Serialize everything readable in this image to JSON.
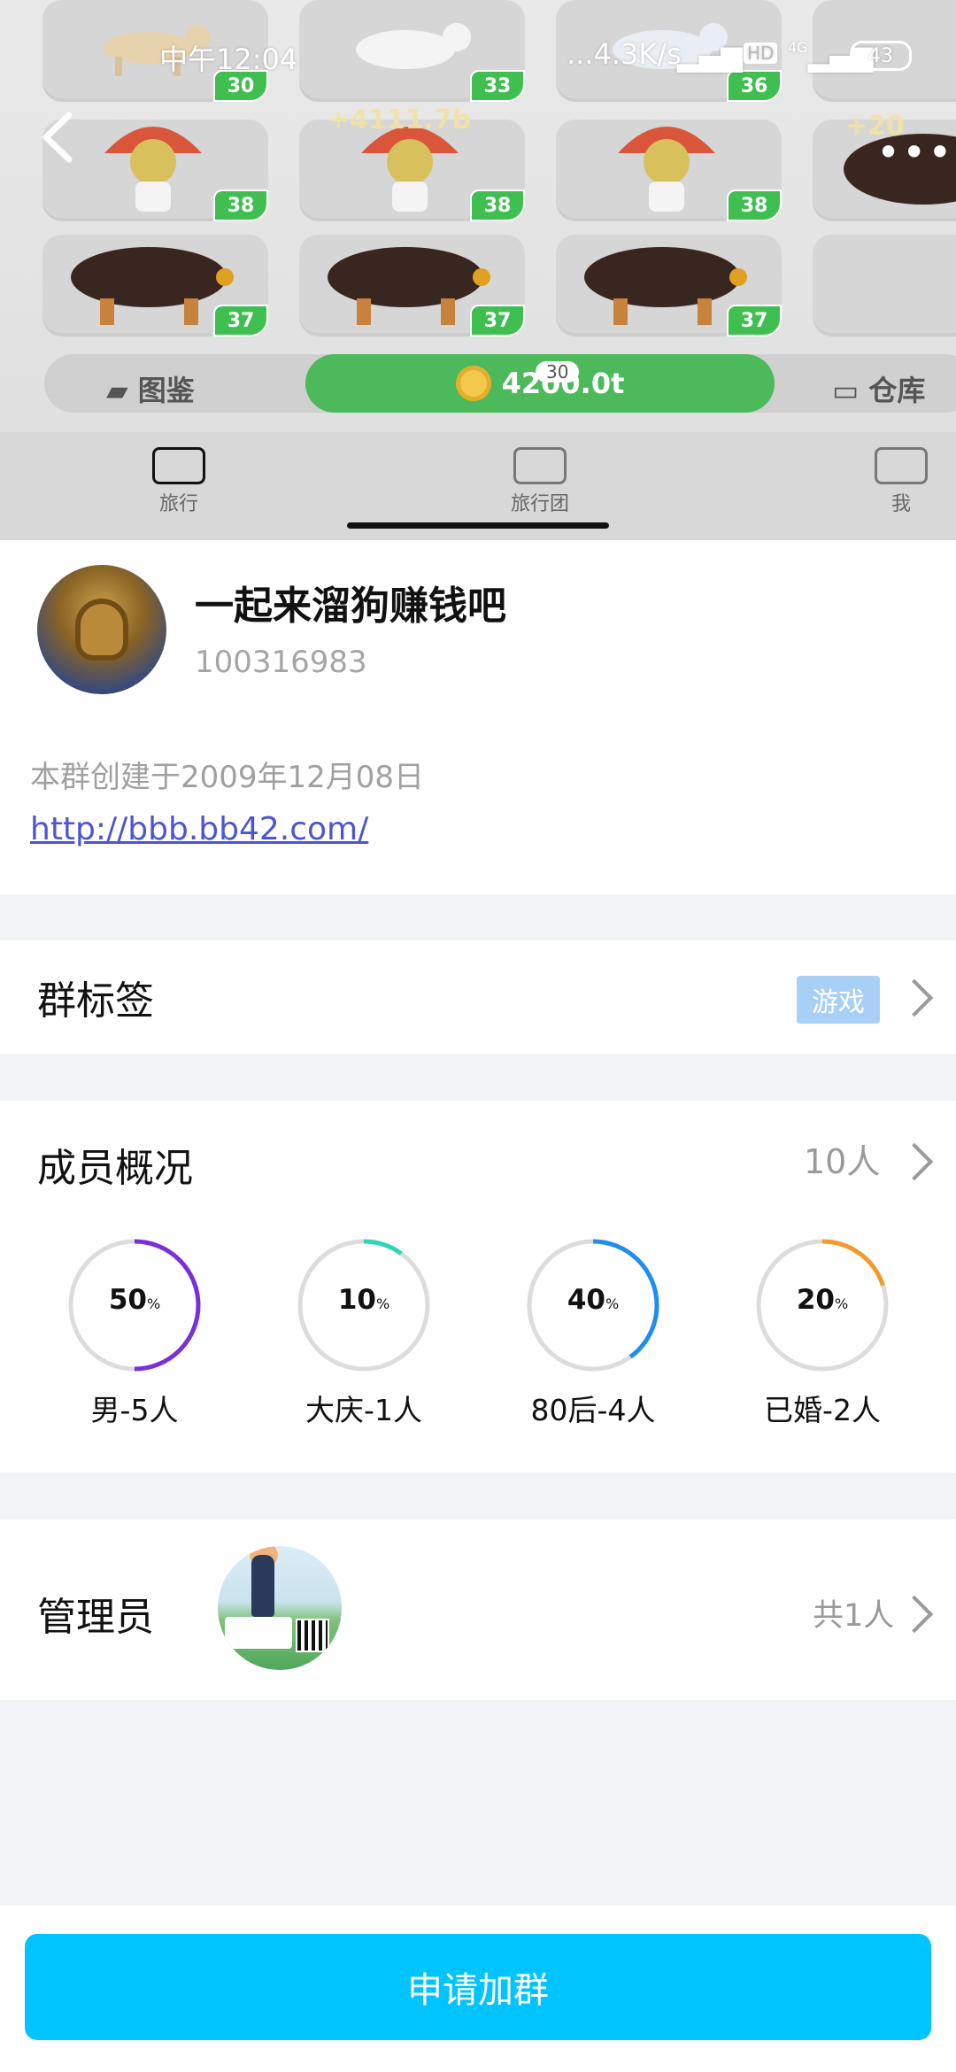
{
  "status_bar": {
    "time": "中午12:04",
    "network_speed": "...4.3K/s",
    "hd": "HD",
    "network_type": "4G",
    "battery": "43"
  },
  "banner": {
    "tiles": [
      {
        "level": "30"
      },
      {
        "level": "33"
      },
      {
        "level": "36"
      },
      {
        "level": "38"
      },
      {
        "level": "38"
      },
      {
        "level": "38"
      },
      {
        "level": "37"
      },
      {
        "level": "37"
      },
      {
        "level": "37"
      }
    ],
    "gain_left": "+4111.7b",
    "gain_right": "+20",
    "left_button": "图鉴",
    "center_badge": "30",
    "center_value": "4200.0t",
    "right_button": "仓库",
    "tabs": [
      "旅行",
      "旅行团",
      "我"
    ]
  },
  "group": {
    "name": "一起来溜狗赚钱吧",
    "id": "100316983",
    "created": "本群创建于2009年12月08日",
    "link": "http://bbb.bb42.com/"
  },
  "tags": {
    "title": "群标签",
    "chip": "游戏"
  },
  "members": {
    "title": "成员概况",
    "count": "10人",
    "stats": [
      {
        "percent": "50",
        "unit": "%",
        "label": "男-5人",
        "value": 0.5,
        "color": "#7a2fdc"
      },
      {
        "percent": "10",
        "unit": "%",
        "label": "大庆-1人",
        "value": 0.1,
        "color": "#2ed6b8"
      },
      {
        "percent": "40",
        "unit": "%",
        "label": "80后-4人",
        "value": 0.4,
        "color": "#1f8ef0"
      },
      {
        "percent": "20",
        "unit": "%",
        "label": "已婚-2人",
        "value": 0.2,
        "color": "#f39a2b"
      }
    ]
  },
  "admins": {
    "title": "管理员",
    "total": "共1人"
  },
  "join_button": "申请加群",
  "colors": {
    "accent": "#00c4ff",
    "link": "#4a55d6",
    "tag_chip": "#a8d0f6",
    "game_green": "#4cb95a"
  }
}
